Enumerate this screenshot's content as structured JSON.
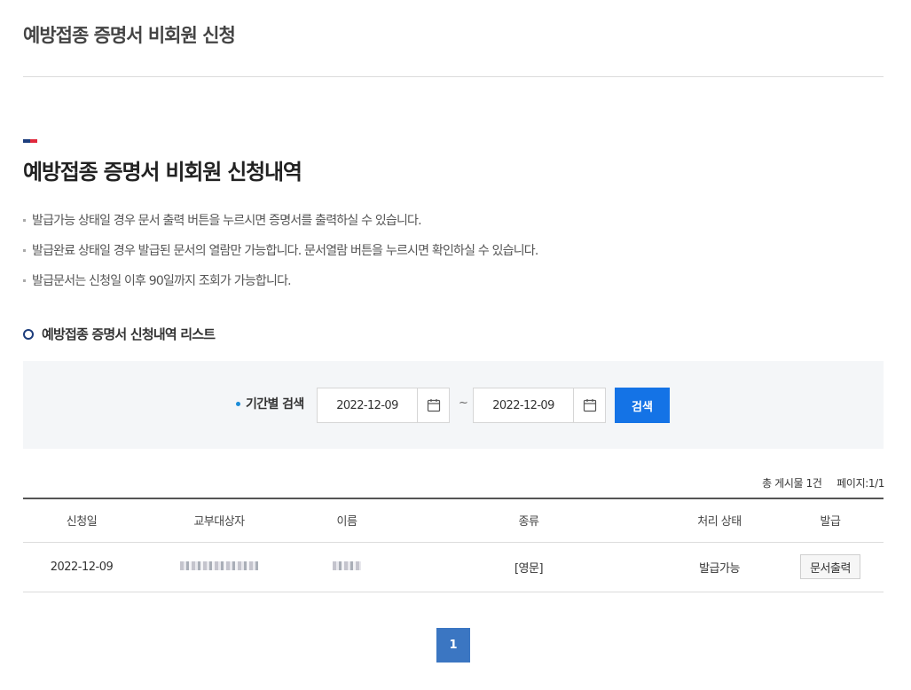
{
  "page": {
    "title": "예방접종 증명서 비회원 신청"
  },
  "section": {
    "title": "예방접종 증명서 비회원 신청내역",
    "accent_colors": [
      "#1d3d7c",
      "#e0283c"
    ]
  },
  "notices": [
    "발급가능 상태일 경우 문서 출력 버튼을 누르시면 증명서를 출력하실 수 있습니다.",
    "발급완료 상태일 경우 발급된 문서의 열람만 가능합니다. 문서열람 버튼을 누르시면 확인하실 수 있습니다.",
    "발급문서는 신청일 이후 90일까지 조회가 가능합니다."
  ],
  "list": {
    "title": "예방접종 증명서 신청내역 리스트"
  },
  "search": {
    "label": "기간별 검색",
    "start_date": "2022-12-09",
    "end_date": "2022-12-09",
    "separator": "~",
    "button_label": "검색",
    "calendar_icon": "calendar-icon"
  },
  "board": {
    "total_label": "총 게시물",
    "total_value": "1건",
    "page_label": "페이지:",
    "page_value": "1/1"
  },
  "table": {
    "headers": [
      "신청일",
      "교부대상자",
      "이름",
      "종류",
      "처리 상태",
      "발급"
    ],
    "rows": [
      {
        "date": "2022-12-09",
        "kind": "[영문]",
        "status": "발급가능",
        "action_label": "문서출력"
      }
    ]
  },
  "pagination": {
    "current": "1"
  },
  "colors": {
    "primary_button": "#1473e6",
    "page_active": "#3b76c2",
    "search_bg": "#f4f6f8",
    "bullet_dot": "#1a8cd8"
  }
}
